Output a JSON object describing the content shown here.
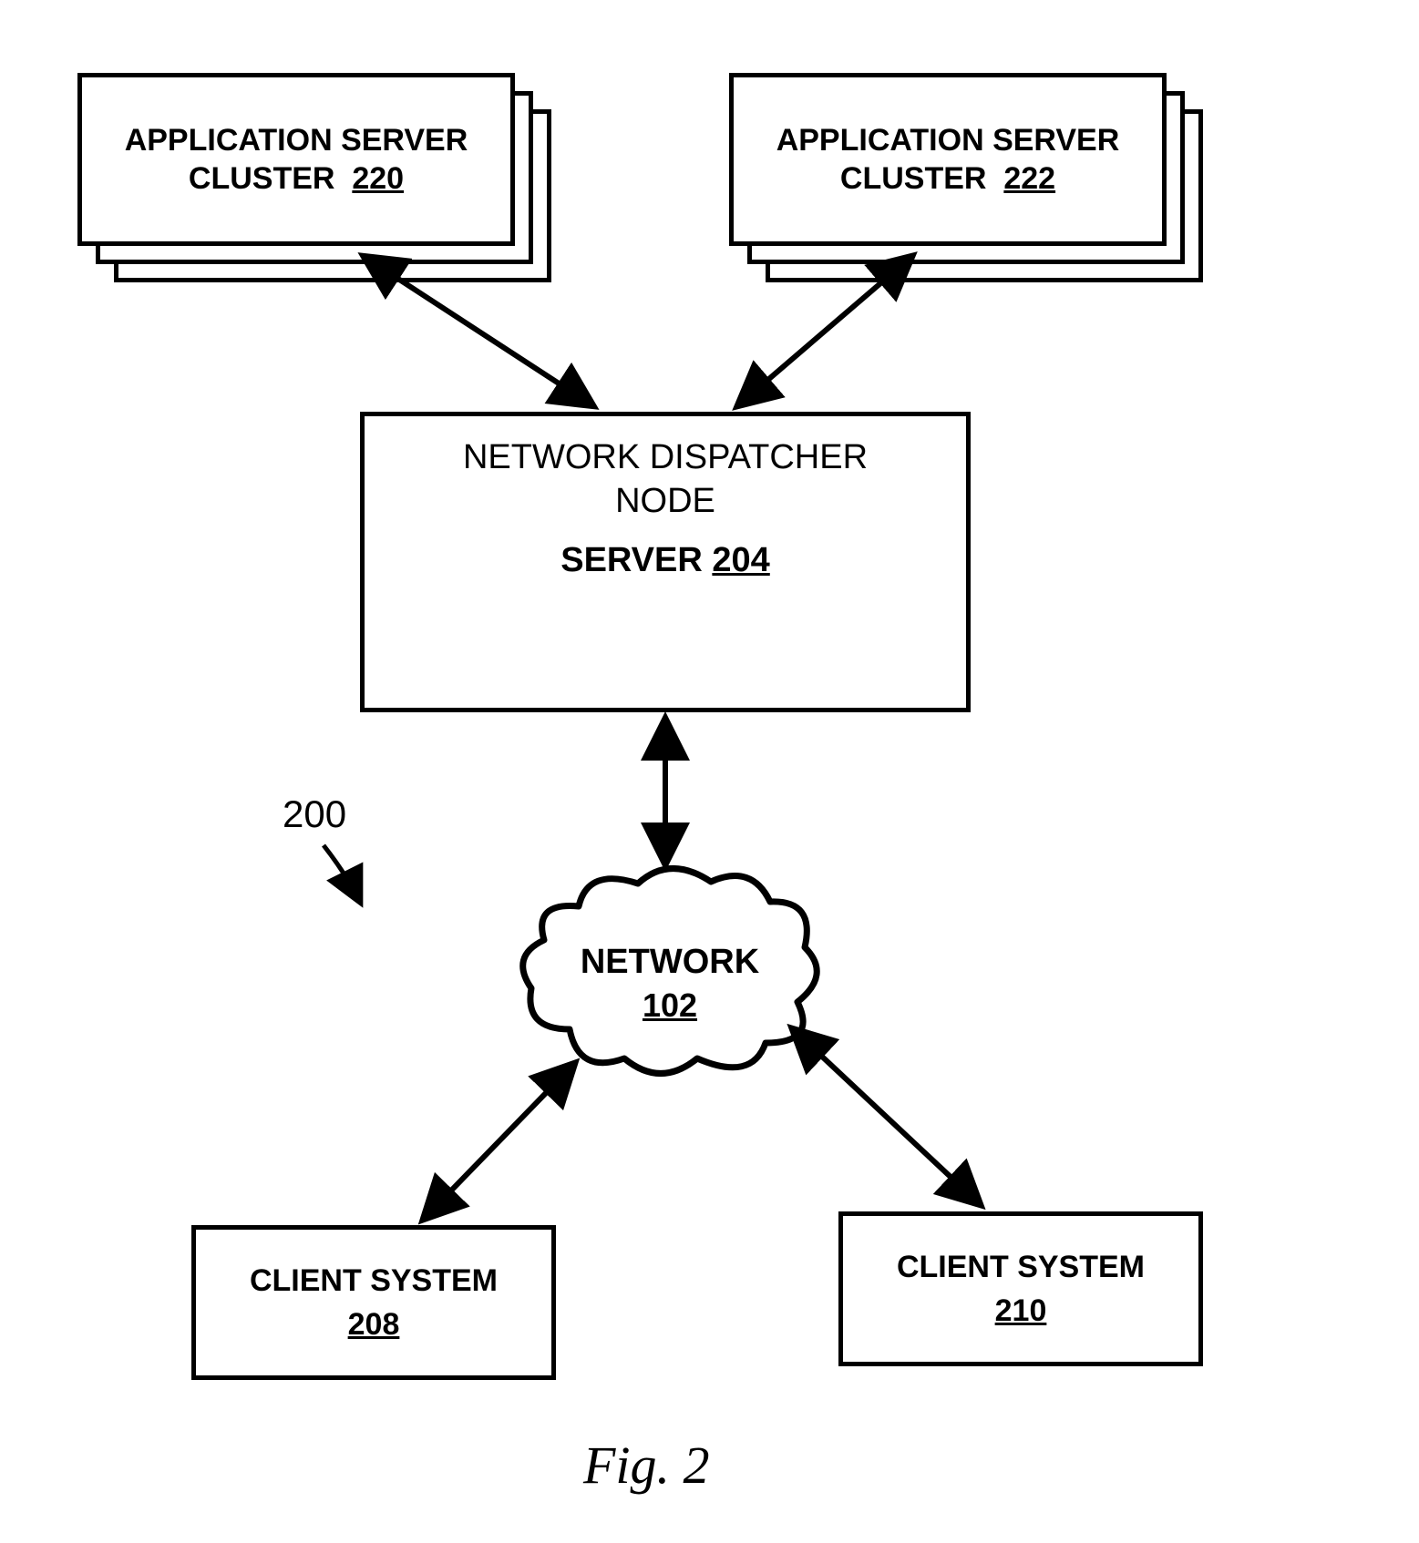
{
  "clusters": {
    "left": {
      "line1": "APPLICATION SERVER",
      "line2": "CLUSTER",
      "ref": "220"
    },
    "right": {
      "line1": "APPLICATION SERVER",
      "line2": "CLUSTER",
      "ref": "222"
    }
  },
  "dispatcher": {
    "line1": "NETWORK DISPATCHER",
    "line2": "NODE",
    "server_label": "SERVER",
    "server_ref": "204"
  },
  "network": {
    "label": "NETWORK",
    "ref": "102"
  },
  "clients": {
    "left": {
      "label": "CLIENT SYSTEM",
      "ref": "208"
    },
    "right": {
      "label": "CLIENT SYSTEM",
      "ref": "210"
    }
  },
  "system_ref": "200",
  "figure_caption": "Fig. 2"
}
